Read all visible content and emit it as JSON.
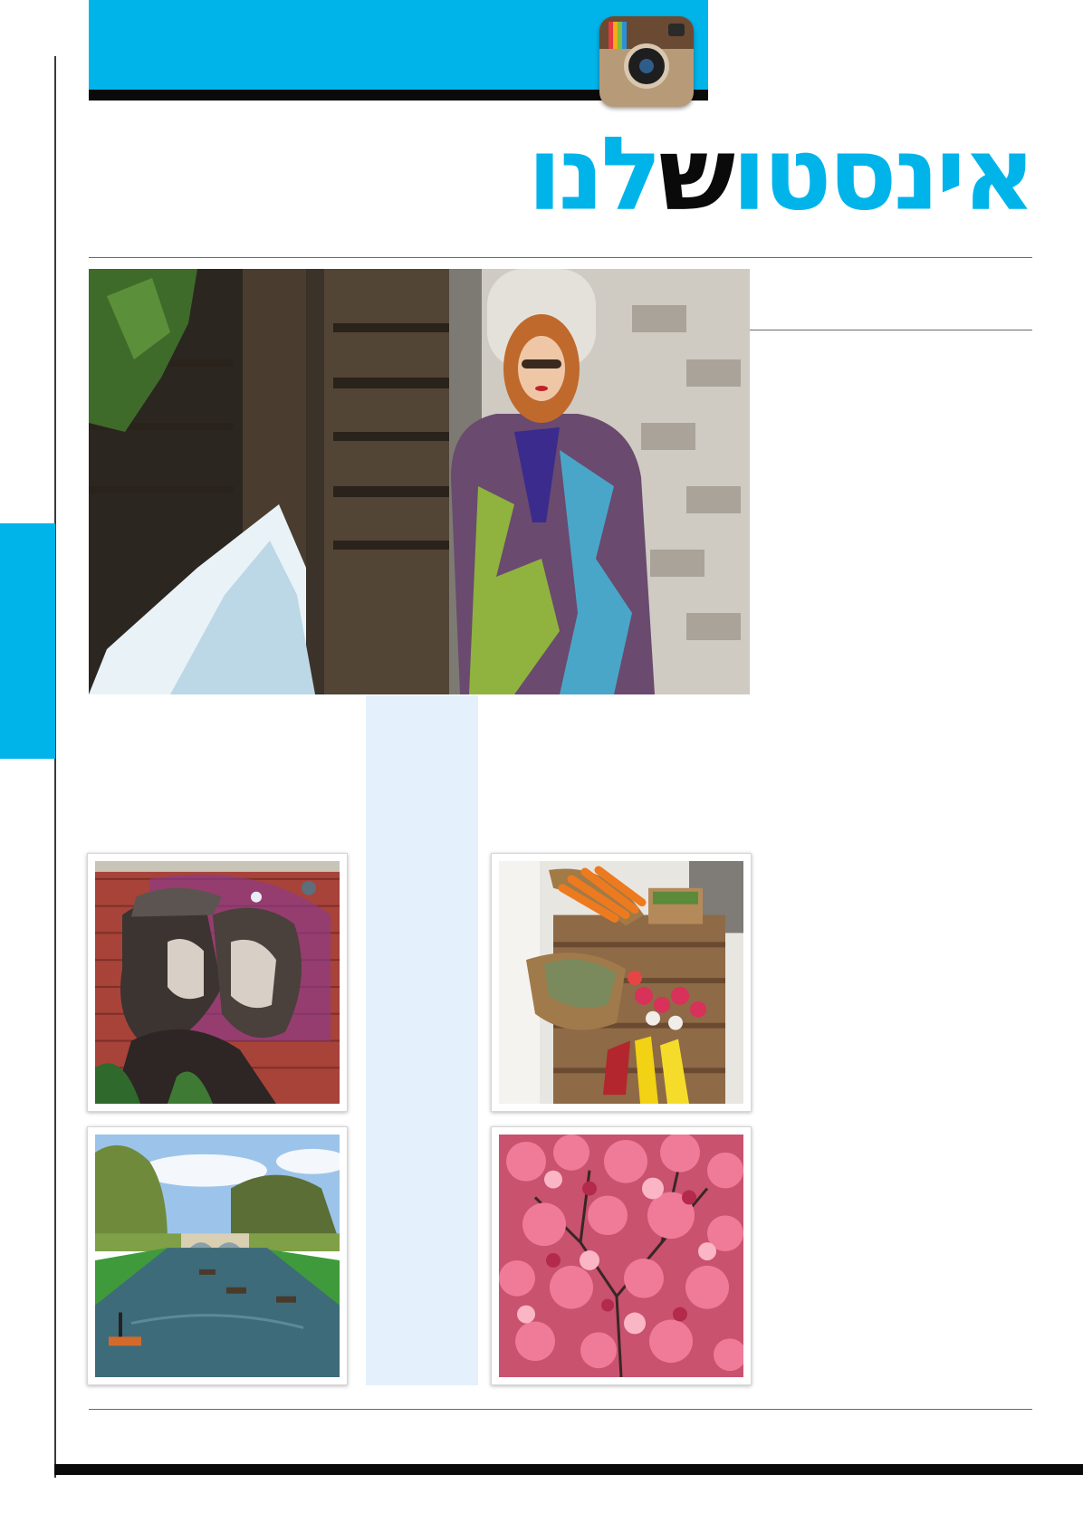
{
  "header": {
    "title_part_1": "אינסטו",
    "title_accent": "ש",
    "title_part_2": "לנו",
    "logo_icon": "instagram-camera-icon",
    "brand_color": "#00b4ea",
    "accent_color": "#0a0a0a"
  },
  "photos": {
    "main": {
      "icon": "portrait-photo"
    },
    "grid": [
      {
        "icon": "street-mural-photo"
      },
      {
        "icon": "vegetable-stall-photo"
      },
      {
        "icon": "river-punting-photo"
      },
      {
        "icon": "cherry-blossom-photo"
      }
    ]
  }
}
